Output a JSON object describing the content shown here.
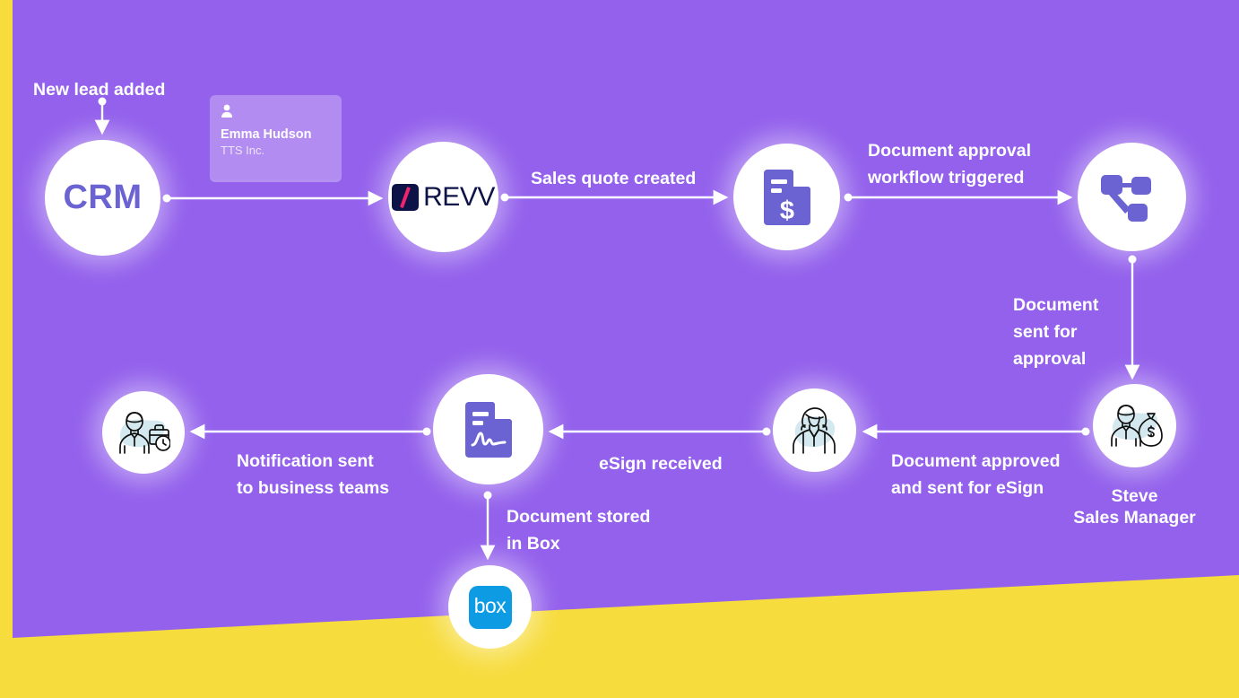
{
  "palette": {
    "background_yellow": "#f7dc3e",
    "panel_purple": "#9361ec",
    "card_purple": "#b28cf0",
    "icon_periwinkle": "#6b63d2",
    "crm_text": "#6b63d2",
    "connector_white": "#ffffff",
    "revv_navy": "#0d1347",
    "revv_pink": "#f0246e",
    "box_blue": "#0d9ce4",
    "illustration_accent_blue": "#d4e8ef"
  },
  "nodes": {
    "crm": {
      "label": "CRM",
      "icon": "crm-text-logo"
    },
    "revv": {
      "label": "REVV",
      "icon": "revv-logo"
    },
    "quote": {
      "icon": "document-dollar-icon"
    },
    "workflow": {
      "icon": "workflow-sitemap-icon"
    },
    "steve": {
      "icon": "businessman-money-bag-icon"
    },
    "esign": {
      "icon": "businesswoman-icon"
    },
    "signed_doc": {
      "icon": "document-signature-icon"
    },
    "business_teams": {
      "icon": "businessman-briefcase-clock-icon"
    },
    "box": {
      "label": "box",
      "icon": "box-logo"
    }
  },
  "labels": {
    "new_lead": "New lead added",
    "sales_quote": "Sales quote created",
    "document_approval": "Document approval\nworkflow triggered",
    "document_sent": "Document\nsent for\napproval",
    "document_approved": "Document approved\nand sent for eSign",
    "esign_received": "eSign received",
    "notification_sent": "Notification sent\nto business teams",
    "document_stored": "Document stored\nin Box"
  },
  "person_label": {
    "name": "Steve",
    "role": "Sales Manager",
    "combined": "Steve\nSales Manager"
  },
  "contact_card": {
    "icon": "person-icon",
    "name": "Emma Hudson",
    "company": "TTS Inc."
  }
}
